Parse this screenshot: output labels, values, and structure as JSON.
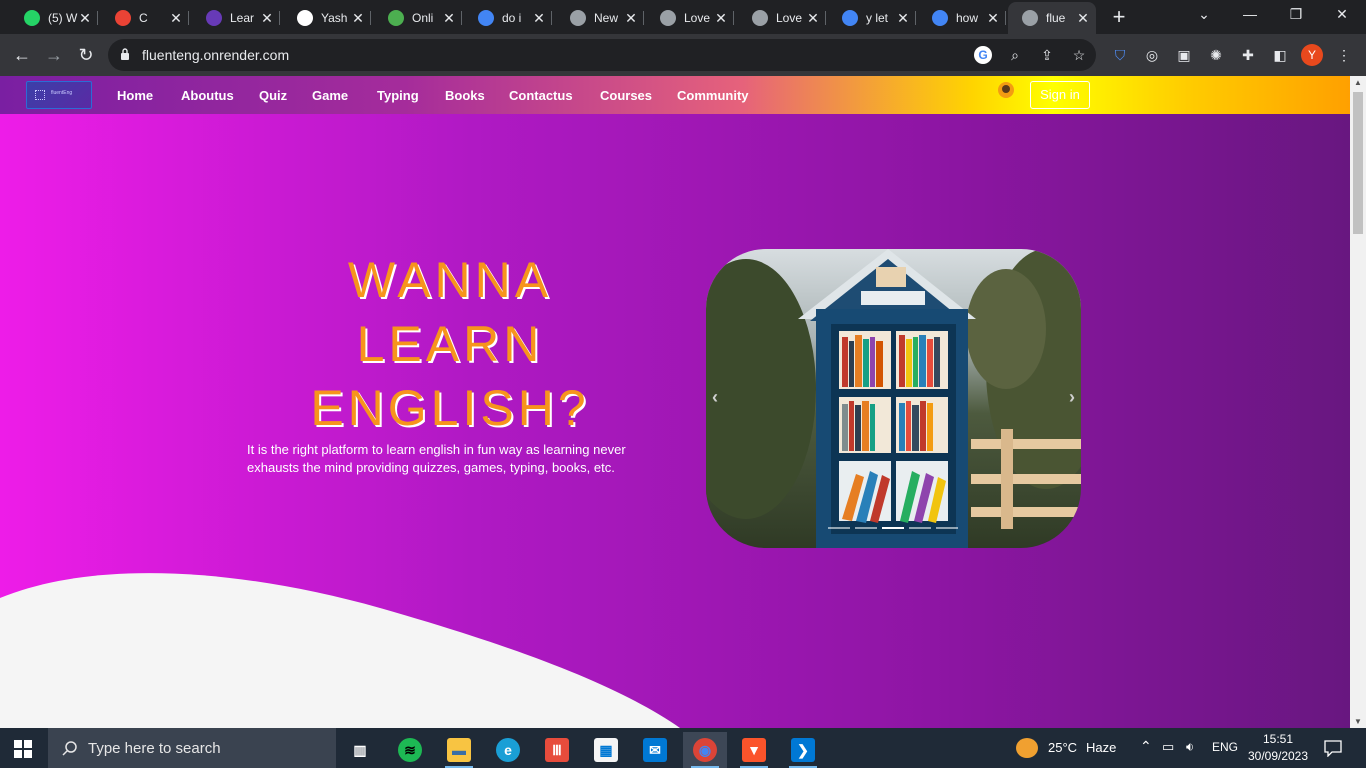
{
  "browser": {
    "tabs": [
      {
        "title": "(5) W",
        "favicon": "whatsapp-icon",
        "color": "#25d366"
      },
      {
        "title": "C",
        "favicon": "gmail-icon",
        "color": "#ea4335"
      },
      {
        "title": "Lear",
        "favicon": "forms-icon",
        "color": "#673ab7"
      },
      {
        "title": "Yash",
        "favicon": "github-icon",
        "color": "#ffffff"
      },
      {
        "title": "Onli",
        "favicon": "leaf-icon",
        "color": "#4caf50"
      },
      {
        "title": "do i",
        "favicon": "google-icon",
        "color": "#4285f4"
      },
      {
        "title": "New",
        "favicon": "chrome-icon",
        "color": "#9aa0a6"
      },
      {
        "title": "Love",
        "favicon": "globe-icon",
        "color": "#9aa0a6"
      },
      {
        "title": "Love",
        "favicon": "globe-icon",
        "color": "#9aa0a6"
      },
      {
        "title": "y let",
        "favicon": "google-icon",
        "color": "#4285f4"
      },
      {
        "title": "how",
        "favicon": "google-icon",
        "color": "#4285f4"
      },
      {
        "title": "flue",
        "favicon": "globe-icon",
        "color": "#9aa0a6",
        "active": true
      }
    ],
    "url": "fluenteng.onrender.com",
    "profile_initial": "Y"
  },
  "site": {
    "logo_text": "fluentEng",
    "nav": [
      "Home",
      "Aboutus",
      "Quiz",
      "Game",
      "Typing",
      "Books",
      "Contactus",
      "Courses",
      "Community"
    ],
    "signin_label": "Sign in",
    "hero_title_lines": [
      "WANNA",
      "LEARN",
      "ENGLISH?"
    ],
    "hero_description": "It is the right platform to learn english in fun way as learning never exhausts the mind providing quizzes, games, typing, books, etc.",
    "carousel": {
      "prev_label": "‹",
      "next_label": "›",
      "indicator_count": 5,
      "active_index": 2
    }
  },
  "taskbar": {
    "search_placeholder": "Type here to search",
    "weather_temp": "25°C",
    "weather_cond": "Haze",
    "language": "ENG",
    "time": "15:51",
    "date": "30/09/2023",
    "apps": [
      "task-view-icon",
      "spotify-icon",
      "file-explorer-icon",
      "edge-icon",
      "app-red-icon",
      "store-icon",
      "mail-icon",
      "chrome-icon",
      "brave-icon",
      "vscode-icon"
    ]
  },
  "colors": {
    "accent_title": "#f7941d",
    "page_gradient_start": "#ee1ce8",
    "page_gradient_end": "#681780"
  }
}
